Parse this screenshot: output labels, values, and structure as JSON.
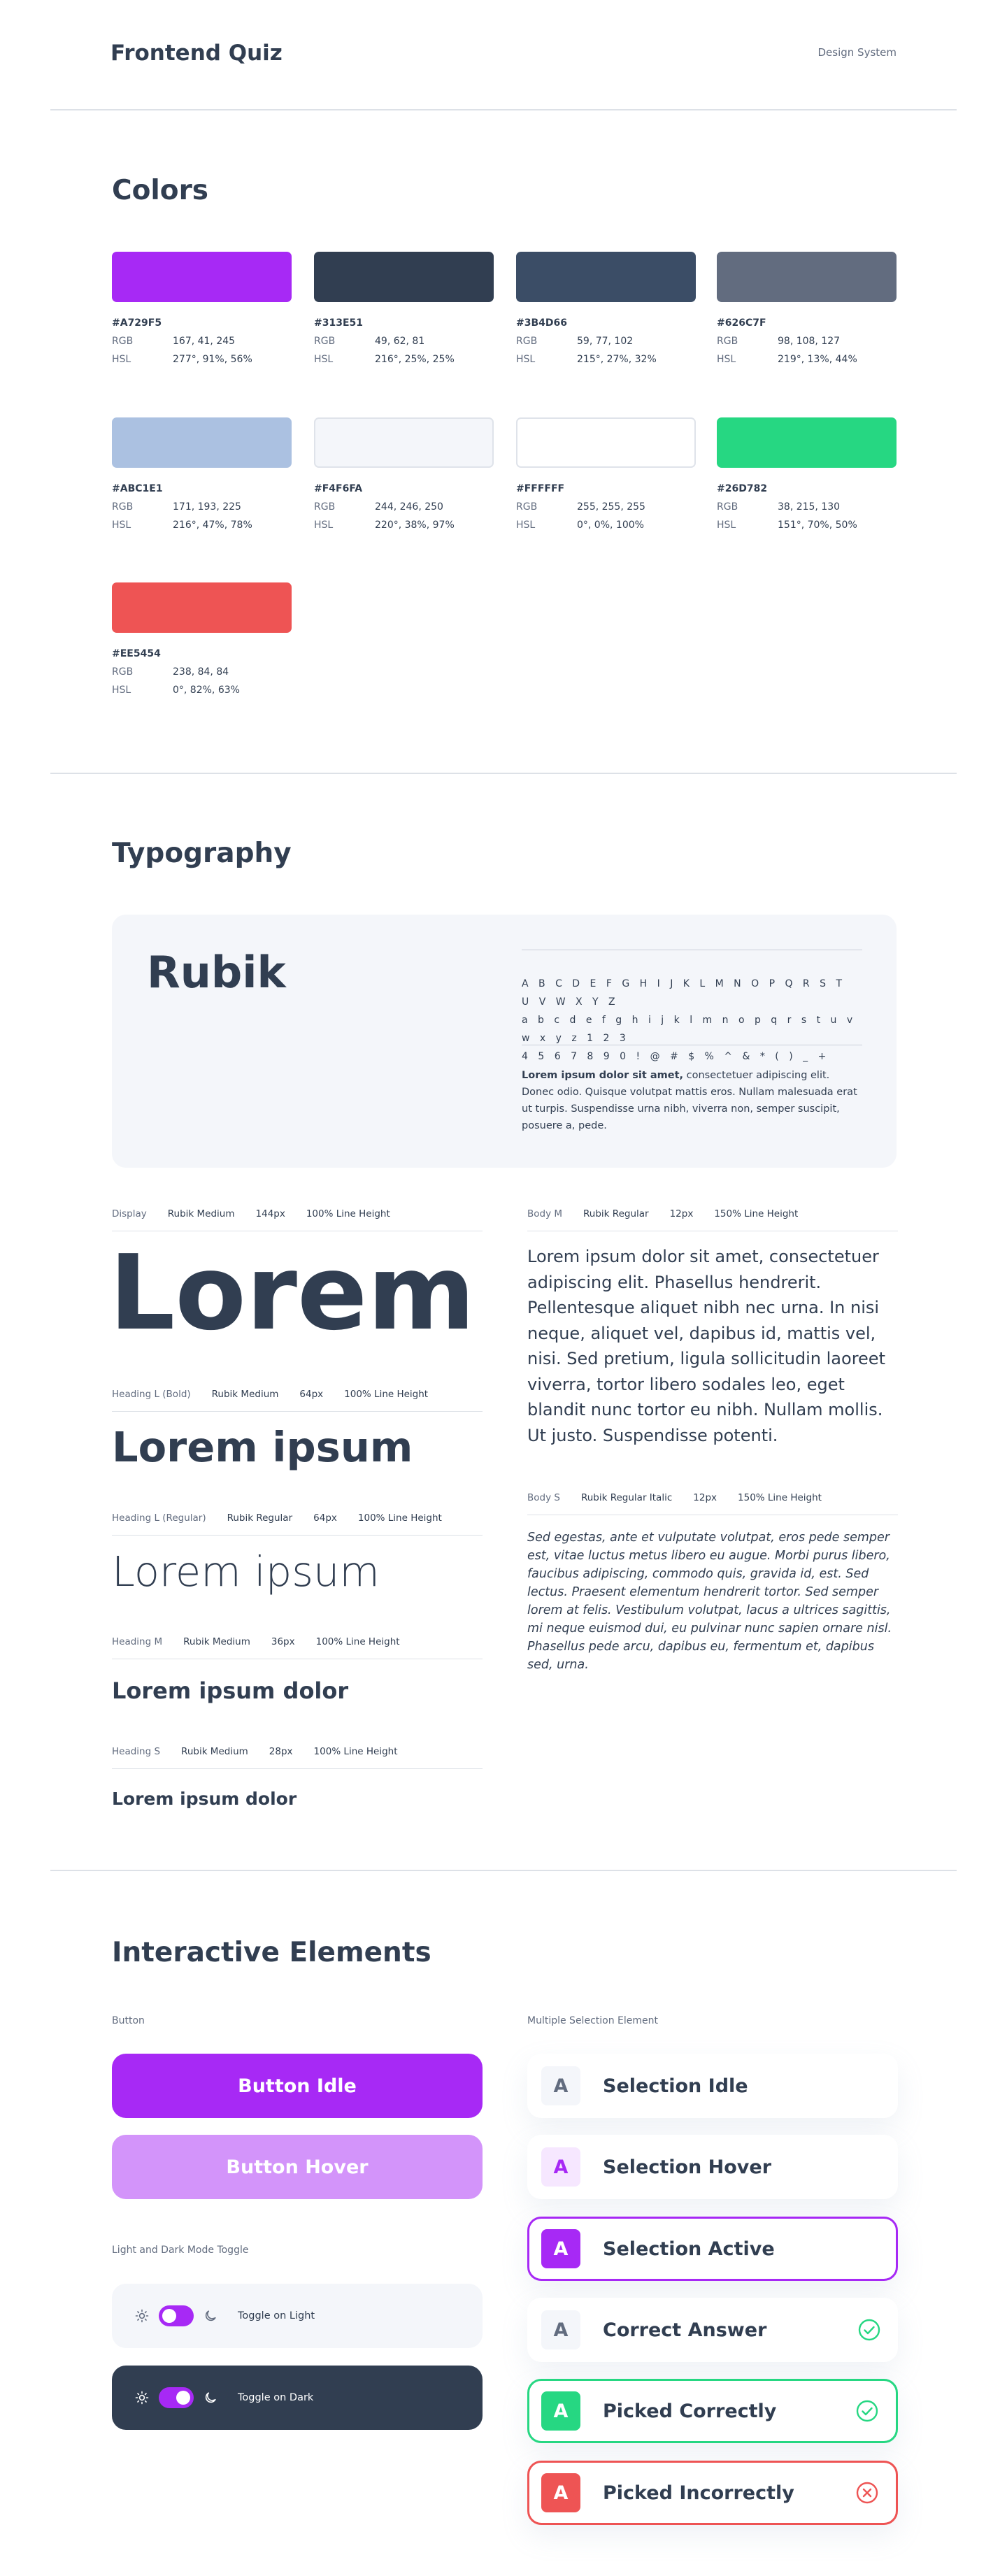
{
  "header": {
    "title": "Frontend Quiz",
    "tag": "Design System"
  },
  "colors": {
    "title": "Colors",
    "rgb_label": "RGB",
    "hsl_label": "HSL",
    "swatches": [
      {
        "hex": "#A729F5",
        "rgb": "167, 41, 245",
        "hsl": "277°, 91%, 56%",
        "color": "#A729F5"
      },
      {
        "hex": "#313E51",
        "rgb": "49, 62, 81",
        "hsl": "216°, 25%, 25%",
        "color": "#313E51"
      },
      {
        "hex": "#3B4D66",
        "rgb": "59, 77, 102",
        "hsl": "215°, 27%, 32%",
        "color": "#3B4D66"
      },
      {
        "hex": "#626C7F",
        "rgb": "98, 108, 127",
        "hsl": "219°, 13%, 44%",
        "color": "#626C7F"
      },
      {
        "hex": "#ABC1E1",
        "rgb": "171, 193, 225",
        "hsl": "216°, 47%, 78%",
        "color": "#ABC1E1"
      },
      {
        "hex": "#F4F6FA",
        "rgb": "244, 246, 250",
        "hsl": "220°, 38%, 97%",
        "color": "#F4F6FA"
      },
      {
        "hex": "#FFFFFF",
        "rgb": "255, 255, 255",
        "hsl": "0°, 0%, 100%",
        "color": "#FFFFFF"
      },
      {
        "hex": "#26D782",
        "rgb": "38, 215, 130",
        "hsl": "151°, 70%, 50%",
        "color": "#26D782"
      },
      {
        "hex": "#EE5454",
        "rgb": "238, 84, 84",
        "hsl": "0°, 82%, 63%",
        "color": "#EE5454"
      }
    ]
  },
  "typography": {
    "title": "Typography",
    "family": "Rubik",
    "chars_line1": "A B C D E F G H I J K L M N O P Q R S T U V W X Y Z",
    "chars_line2": "a b c d e f g h i j k l m n o p q r s t u v w x y z 1 2 3",
    "chars_line3": "4 5 6 7 8 9 0 ! @ # $ % ^ & * ( ) _ +",
    "para_bold": "Lorem ipsum dolor sit amet,",
    "para_rest": " consectetuer adipiscing elit. Donec odio. Quisque volutpat mattis eros. Nullam malesuada erat ut turpis. Suspendisse urna nibh, viverra non, semper suscipit, posuere a, pede.",
    "display": {
      "name": "Display",
      "weight": "Rubik Medium",
      "size": "144px",
      "lh": "100% Line Height",
      "sample": "Lorem"
    },
    "heading_l_bold": {
      "name": "Heading L (Bold)",
      "weight": "Rubik Medium",
      "size": "64px",
      "lh": "100% Line Height",
      "sample": "Lorem ipsum"
    },
    "heading_l_regular": {
      "name": "Heading L (Regular)",
      "weight": "Rubik Regular",
      "size": "64px",
      "lh": "100% Line Height",
      "sample": "Lorem ipsum"
    },
    "heading_m": {
      "name": "Heading M",
      "weight": "Rubik Medium",
      "size": "36px",
      "lh": "100% Line Height",
      "sample": "Lorem ipsum dolor"
    },
    "heading_s": {
      "name": "Heading S",
      "weight": "Rubik Medium",
      "size": "28px",
      "lh": "100% Line Height",
      "sample": "Lorem ipsum dolor"
    },
    "body_m": {
      "name": "Body M",
      "weight": "Rubik Regular",
      "size": "12px",
      "lh": "150% Line Height",
      "sample": "Lorem ipsum dolor sit amet, consectetuer adipiscing elit. Phasellus hendrerit. Pellentesque aliquet nibh nec urna. In nisi neque, aliquet vel, dapibus id, mattis vel, nisi. Sed pretium, ligula sollicitudin laoreet viverra, tortor libero sodales leo, eget blandit nunc tortor eu nibh. Nullam mollis. Ut justo. Suspendisse potenti."
    },
    "body_s": {
      "name": "Body S",
      "weight": "Rubik Regular Italic",
      "size": "12px",
      "lh": "150% Line Height",
      "sample": "Sed egestas, ante et vulputate volutpat, eros pede semper est, vitae luctus metus libero eu augue. Morbi purus libero, faucibus adipiscing, commodo quis, gravida id, est. Sed lectus. Praesent elementum hendrerit tortor. Sed semper lorem at felis. Vestibulum volutpat, lacus a ultrices sagittis, mi neque euismod dui, eu pulvinar nunc sapien ornare nisl. Phasellus pede arcu, dapibus eu, fermentum et, dapibus sed, urna."
    }
  },
  "interactive": {
    "title": "Interactive Elements",
    "button_label": "Button",
    "button_idle": "Button Idle",
    "button_hover": "Button Hover",
    "toggle_label": "Light and Dark Mode Toggle",
    "toggle_light": "Toggle on Light",
    "toggle_dark": "Toggle on Dark",
    "selection_label": "Multiple Selection Element",
    "selections": [
      {
        "letter": "A",
        "text": "Selection Idle",
        "state": "idle"
      },
      {
        "letter": "A",
        "text": "Selection Hover",
        "state": "hover"
      },
      {
        "letter": "A",
        "text": "Selection Active",
        "state": "active"
      },
      {
        "letter": "A",
        "text": "Correct Answer",
        "state": "correct-answer"
      },
      {
        "letter": "A",
        "text": "Picked Correctly",
        "state": "picked-correct"
      },
      {
        "letter": "A",
        "text": "Picked Incorrectly",
        "state": "picked-incorrect"
      }
    ]
  }
}
